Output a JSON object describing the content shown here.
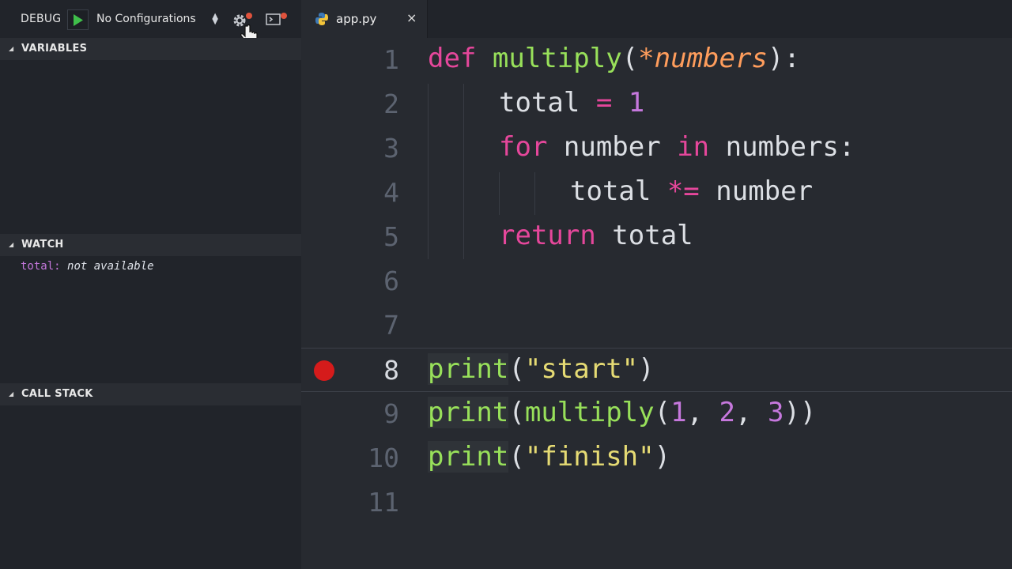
{
  "debug_toolbar": {
    "label": "DEBUG",
    "configuration": "No Configurations"
  },
  "sections": {
    "variables": "VARIABLES",
    "watch": "WATCH",
    "call_stack": "CALL STACK"
  },
  "watch": [
    {
      "name": "total:",
      "value": "not available"
    }
  ],
  "tab": {
    "filename": "app.py",
    "close": "×"
  },
  "editor": {
    "current_line": 8,
    "breakpoint_line": 8,
    "lines": [
      {
        "n": "1",
        "t": [
          "def",
          " ",
          "multiply",
          "(",
          "*numbers",
          "):"
        ]
      },
      {
        "n": "2",
        "t": [
          "total",
          " = ",
          "1"
        ]
      },
      {
        "n": "3",
        "t": [
          "for",
          " number ",
          "in",
          " numbers:"
        ]
      },
      {
        "n": "4",
        "t": [
          "total ",
          "*=",
          " number"
        ]
      },
      {
        "n": "5",
        "t": [
          "return",
          " total"
        ]
      },
      {
        "n": "6",
        "t": []
      },
      {
        "n": "7",
        "t": []
      },
      {
        "n": "8",
        "t": [
          "print",
          "(",
          "\"start\"",
          ")"
        ]
      },
      {
        "n": "9",
        "t": [
          "print",
          "(",
          "multiply",
          "(",
          "1",
          ", ",
          "2",
          ", ",
          "3",
          "))"
        ]
      },
      {
        "n": "10",
        "t": [
          "print",
          "(",
          "\"finish\"",
          ")"
        ]
      },
      {
        "n": "11",
        "t": []
      }
    ]
  },
  "colors": {
    "breakpoint": "#d51b1b",
    "keyword": "#e5479b",
    "function": "#98e05a",
    "number": "#c678dd",
    "string": "#e6db74",
    "parameter": "#ff9d5c"
  },
  "icons": [
    "play-icon",
    "gear-icon",
    "terminal-icon",
    "python-file-icon",
    "close-icon",
    "pointer-hand-icon",
    "breakpoint-icon"
  ]
}
